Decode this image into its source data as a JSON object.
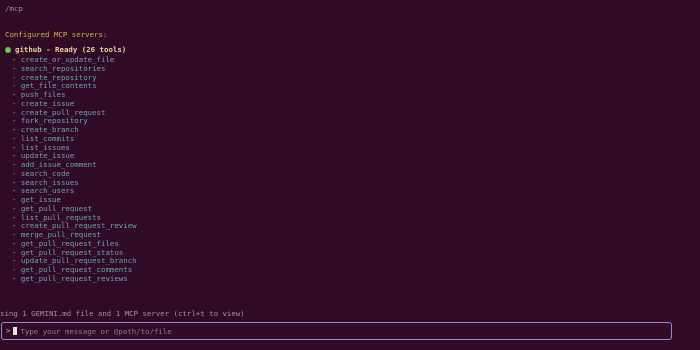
{
  "command_echo": "/mcp",
  "heading": "Configured MCP servers:",
  "server": {
    "name": "github",
    "status": " - Ready (26 tools)",
    "status_color": "#7ec86a"
  },
  "tools": [
    "create_or_update_file",
    "search_repositories",
    "create_repository",
    "get_file_contents",
    "push_files",
    "create_issue",
    "create_pull_request",
    "fork_repository",
    "create_branch",
    "list_commits",
    "list_issues",
    "update_issue",
    "add_issue_comment",
    "search_code",
    "search_issues",
    "search_users",
    "get_issue",
    "get_pull_request",
    "list_pull_requests",
    "create_pull_request_review",
    "merge_pull_request",
    "get_pull_request_files",
    "get_pull_request_status",
    "update_pull_request_branch",
    "get_pull_request_comments",
    "get_pull_request_reviews"
  ],
  "footer_info": "sing 1 GEMINI.md file and 1 MCP server (ctrl+t to view)",
  "input": {
    "prompt": ">",
    "placeholder": "Type your message or @path/to/file",
    "value": ""
  },
  "colors": {
    "background": "#2f0b25",
    "accent_heading": "#e8a35c",
    "tool_text": "#6fa0ab",
    "input_border": "#8f8ad0"
  }
}
